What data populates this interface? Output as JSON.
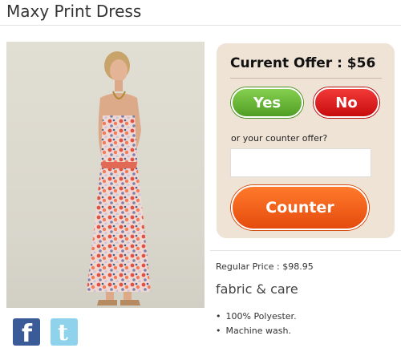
{
  "product": {
    "title": "Maxy Print Dress",
    "regular_price": "Regular Price : $98.95",
    "fabric_heading": "fabric & care",
    "care_items": [
      "100% Polyester.",
      "Machine wash."
    ]
  },
  "offer": {
    "title": "Current Offer : $56",
    "yes_label": "Yes",
    "no_label": "No",
    "counter_prompt": "or your counter offer?",
    "counter_input_value": "",
    "counter_label": "Counter"
  },
  "social": {
    "facebook_glyph": "f",
    "twitter_glyph": "t",
    "facebook_icon": "facebook-icon",
    "twitter_icon": "twitter-icon"
  },
  "colors": {
    "offer_box": "#efe3d6",
    "yes_button": "#5fb32e",
    "no_button": "#e11b1b",
    "counter_button": "#f2631c",
    "facebook": "#3b5a98",
    "twitter": "#8fd2ec"
  }
}
